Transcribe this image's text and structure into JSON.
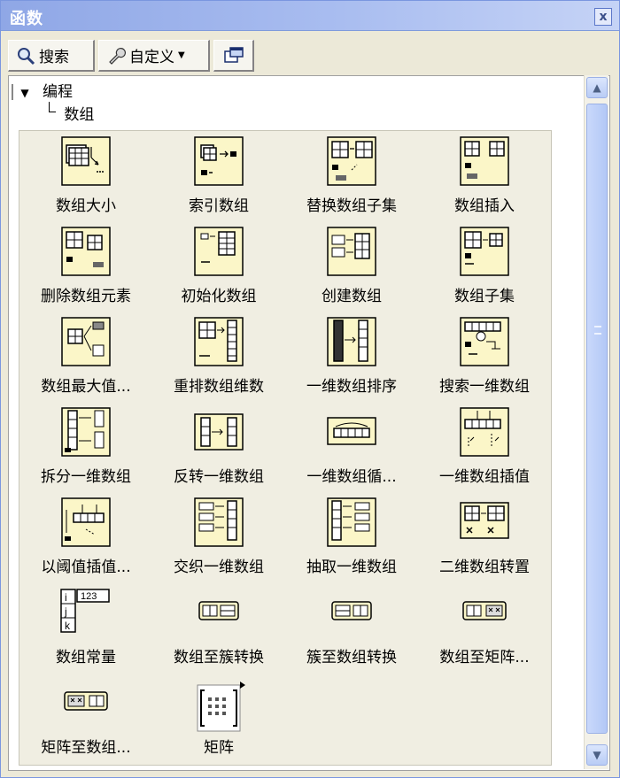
{
  "window": {
    "title": "函数",
    "close_glyph": "x"
  },
  "toolbar": {
    "search_label": "搜索",
    "customize_label": "自定义"
  },
  "tree": {
    "root_label": "编程",
    "child_label": "数组"
  },
  "items": [
    {
      "label": "数组大小",
      "icon": "array-size-icon"
    },
    {
      "label": "索引数组",
      "icon": "index-array-icon"
    },
    {
      "label": "替换数组子集",
      "icon": "replace-array-subset-icon"
    },
    {
      "label": "数组插入",
      "icon": "insert-into-array-icon"
    },
    {
      "label": "删除数组元素",
      "icon": "delete-from-array-icon"
    },
    {
      "label": "初始化数组",
      "icon": "initialize-array-icon"
    },
    {
      "label": "创建数组",
      "icon": "build-array-icon"
    },
    {
      "label": "数组子集",
      "icon": "array-subset-icon"
    },
    {
      "label": "数组最大值...",
      "icon": "array-max-min-icon"
    },
    {
      "label": "重排数组维数",
      "icon": "reshape-array-icon"
    },
    {
      "label": "一维数组排序",
      "icon": "sort-1d-array-icon"
    },
    {
      "label": "搜索一维数组",
      "icon": "search-1d-array-icon"
    },
    {
      "label": "拆分一维数组",
      "icon": "split-1d-array-icon"
    },
    {
      "label": "反转一维数组",
      "icon": "reverse-1d-array-icon"
    },
    {
      "label": "一维数组循...",
      "icon": "rotate-1d-array-icon"
    },
    {
      "label": "一维数组插值",
      "icon": "interpolate-1d-array-icon"
    },
    {
      "label": "以阈值插值...",
      "icon": "threshold-1d-array-icon"
    },
    {
      "label": "交织一维数组",
      "icon": "interleave-1d-arrays-icon"
    },
    {
      "label": "抽取一维数组",
      "icon": "decimate-1d-array-icon"
    },
    {
      "label": "二维数组转置",
      "icon": "transpose-2d-array-icon"
    },
    {
      "label": "数组常量",
      "icon": "array-constant-icon"
    },
    {
      "label": "数组至簇转换",
      "icon": "array-to-cluster-icon"
    },
    {
      "label": "簇至数组转换",
      "icon": "cluster-to-array-icon"
    },
    {
      "label": "数组至矩阵...",
      "icon": "array-to-matrix-icon"
    },
    {
      "label": "矩阵至数组...",
      "icon": "matrix-to-array-icon"
    },
    {
      "label": "矩阵",
      "icon": "matrix-icon"
    }
  ],
  "array_constant_text": "123",
  "array_constant_indices": [
    "i",
    "j",
    "k"
  ]
}
